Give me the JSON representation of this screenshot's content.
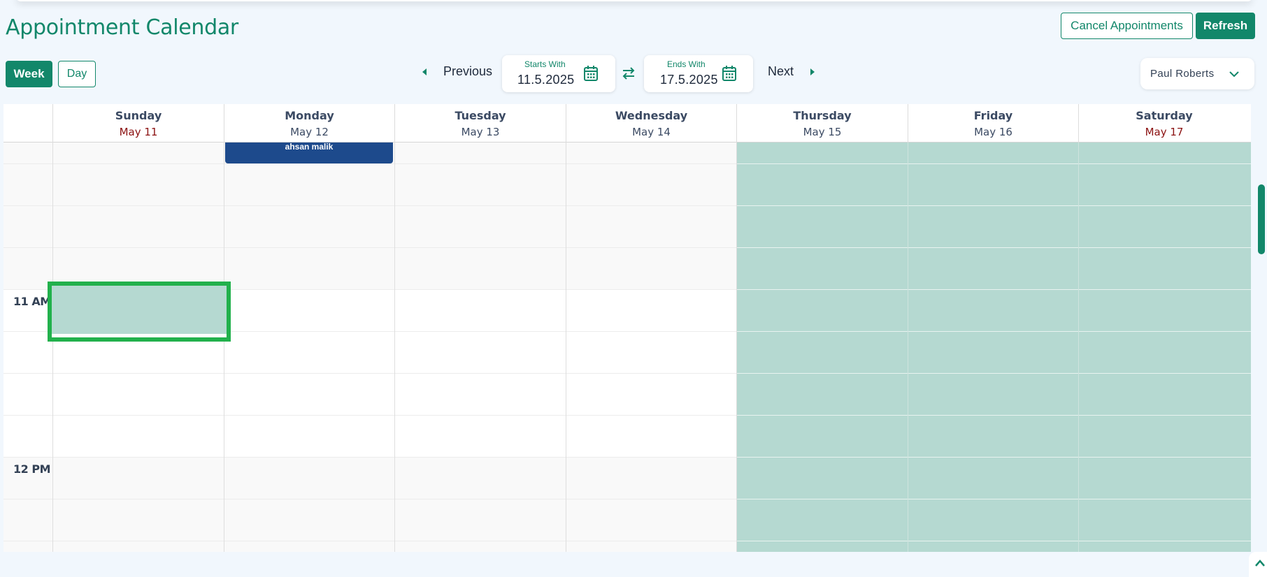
{
  "page": {
    "title": "Appointment Calendar"
  },
  "actions": {
    "cancel_label": "Cancel Appointments",
    "refresh_label": "Refresh"
  },
  "view_toggle": {
    "week_label": "Week",
    "day_label": "Day",
    "active": "Week"
  },
  "date_nav": {
    "previous_label": "Previous",
    "next_label": "Next",
    "start_label": "Starts With",
    "start_value": "11.5.2025",
    "end_label": "Ends With",
    "end_value": "17.5.2025",
    "icons": [
      "calendar-icon",
      "swap-icon",
      "caret-left-icon",
      "caret-right-icon"
    ]
  },
  "user_select": {
    "selected": "Paul Roberts",
    "icon": "chevron-down-icon"
  },
  "calendar": {
    "days": [
      {
        "name": "Sunday",
        "date": "May 11",
        "weekend": true
      },
      {
        "name": "Monday",
        "date": "May 12",
        "weekend": false
      },
      {
        "name": "Tuesday",
        "date": "May 13",
        "weekend": false
      },
      {
        "name": "Wednesday",
        "date": "May 14",
        "weekend": false
      },
      {
        "name": "Thursday",
        "date": "May 15",
        "weekend": false
      },
      {
        "name": "Friday",
        "date": "May 16",
        "weekend": false
      },
      {
        "name": "Saturday",
        "date": "May 17",
        "weekend": true
      }
    ],
    "time_labels": [
      "11 AM",
      "12 PM"
    ],
    "appointment": {
      "text": "ahsan malik"
    },
    "colors": {
      "accent": "#12876a",
      "weekend_date": "#8b1111",
      "available": "#b5d9d1",
      "appointment": "#1d4a8c",
      "selection": "#22b14c"
    }
  }
}
